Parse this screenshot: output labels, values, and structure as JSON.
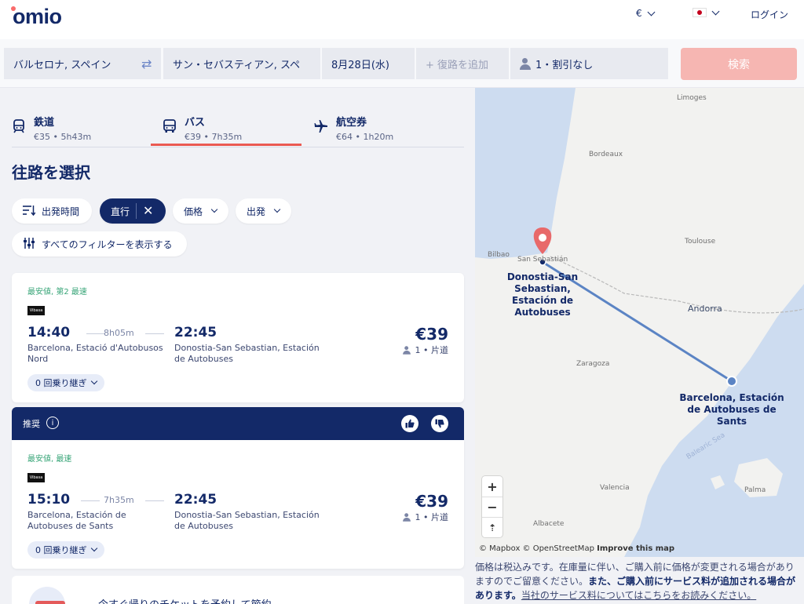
{
  "header": {
    "logo": "omio",
    "currency": "€",
    "language": "ログイン"
  },
  "search": {
    "from": "バルセロナ, スペイン",
    "to": "サン・セバスティアン, スペ",
    "date": "8月28日(水)",
    "return_placeholder": "+ 復路を追加",
    "passengers": "1・割引なし",
    "search_button": "検索"
  },
  "modes": [
    {
      "name": "鉄道",
      "sub": "€35 • 5h43m",
      "icon": "train-icon"
    },
    {
      "name": "バス",
      "sub": "€39 • 7h35m",
      "icon": "bus-icon"
    },
    {
      "name": "航空券",
      "sub": "€64 • 1h20m",
      "icon": "plane-icon"
    }
  ],
  "page_title": "往路を選択",
  "filters": {
    "departure_time": "出発時間",
    "direct": "直行",
    "price": "価格",
    "departure": "出発",
    "all_filters": "すべてのフィルターを表示する"
  },
  "results": [
    {
      "tag": "最安値, 第2 最速",
      "operator": "Vibasa",
      "dep_time": "14:40",
      "duration": "8h05m",
      "arr_time": "22:45",
      "dep_station": "Barcelona, Estació d'Autobusos Nord",
      "arr_station": "Donostia-San Sebastian, Estación de Autobuses",
      "price": "€39",
      "pax": "1 • 片道",
      "transfers": "0 回乗り継ぎ"
    },
    {
      "tag": "最安値, 最速",
      "operator": "Vibasa",
      "dep_time": "15:10",
      "duration": "7h35m",
      "arr_time": "22:45",
      "dep_station": "Barcelona, Estación de Autobuses de Sants",
      "arr_station": "Donostia-San Sebastian, Estación de Autobuses",
      "price": "€39",
      "pax": "1 • 片道",
      "transfers": "0 回乗り継ぎ"
    }
  ],
  "recommended": {
    "label": "推奨",
    "info": "i"
  },
  "promo_text": "今すぐ帰りのチケットを予約して節約",
  "map": {
    "labels": {
      "limoges": "Limoges",
      "bordeaux": "Bordeaux",
      "toulouse": "Toulouse",
      "bilbao": "Bilbao",
      "san_sebastian": "San Sebastián",
      "andorra": "Andorra",
      "zaragoza": "Zaragoza",
      "valencia": "Valencia",
      "albacete": "Albacete",
      "palma": "Palma",
      "balearic_sea": "Balearic Sea"
    },
    "origin_label": "Barcelona, Estación de Autobuses de Sants",
    "dest_label": "Donostia-San Sebastian, Estación de Autobuses",
    "zoom_in": "+",
    "zoom_out": "−",
    "compass": "⇡",
    "attribution": "© Mapbox © OpenStreetMap",
    "improve": "Improve this map"
  },
  "footnote": {
    "part1": "価格は税込みです。在庫量に伴い、ご購入前に価格が変更される場合がありますのでご留意ください。",
    "part2": "また、ご購入前にサービス料が追加される場合があります。",
    "link": "当社のサービス料についてはこちらをお読みください。"
  },
  "colors": {
    "navy": "#132968",
    "coral": "#ea5a52",
    "search_button": "#f6b6b2",
    "green_tag": "#3aa679",
    "route_line": "#5b84c4"
  }
}
